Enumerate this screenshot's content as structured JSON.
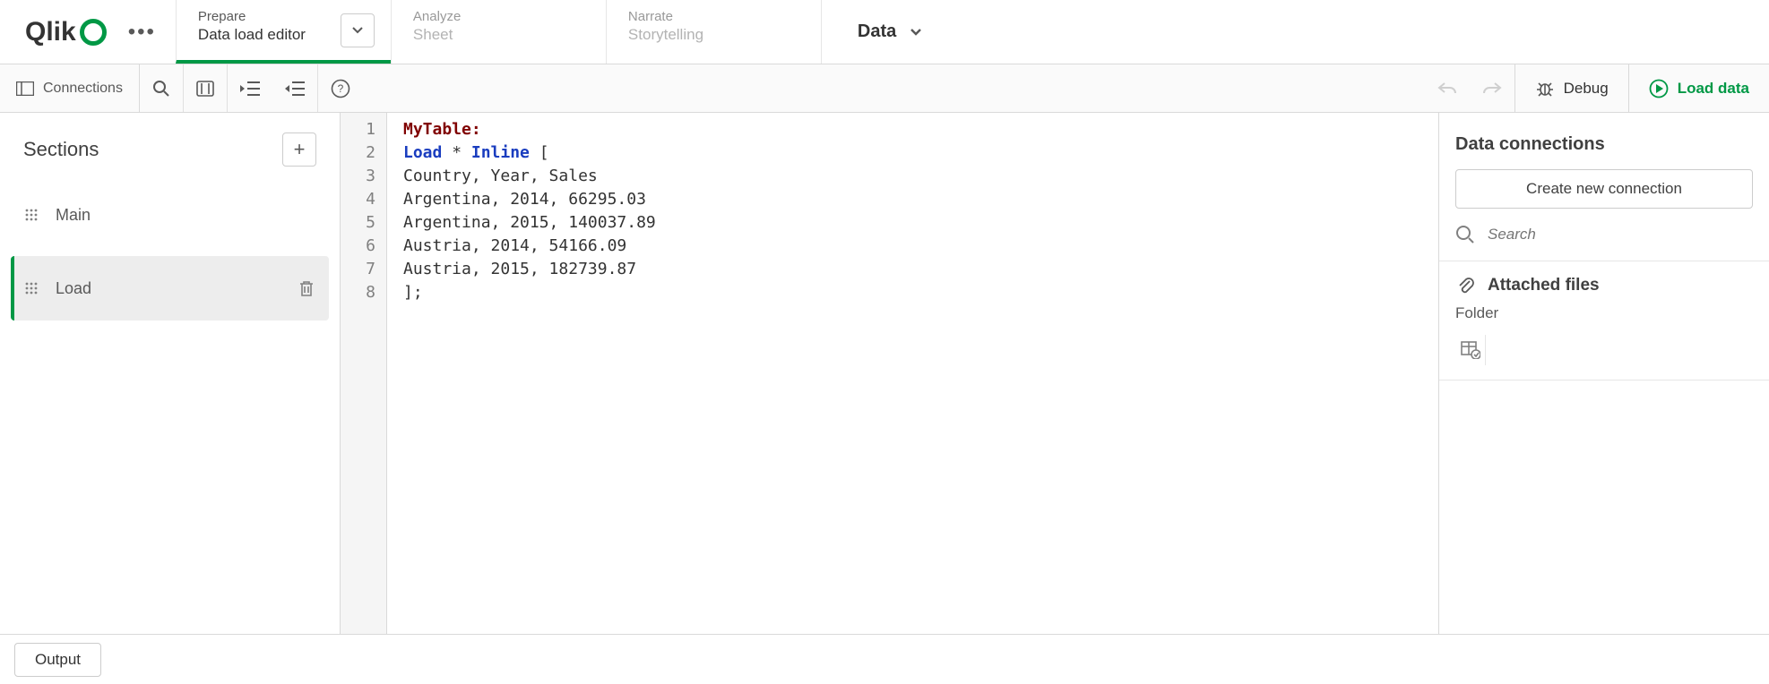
{
  "header": {
    "logo_text": "Qlik",
    "nav": [
      {
        "step": "Prepare",
        "subtitle": "Data load editor",
        "active": true,
        "has_chevron": true
      },
      {
        "step": "Analyze",
        "subtitle": "Sheet",
        "active": false,
        "has_chevron": false
      },
      {
        "step": "Narrate",
        "subtitle": "Storytelling",
        "active": false,
        "has_chevron": false
      }
    ],
    "data_dropdown": "Data"
  },
  "toolbar": {
    "connections_label": "Connections",
    "debug_label": "Debug",
    "load_data_label": "Load data"
  },
  "sections": {
    "title": "Sections",
    "items": [
      {
        "label": "Main",
        "active": false
      },
      {
        "label": "Load",
        "active": true
      }
    ]
  },
  "code": {
    "lines": [
      {
        "n": "1",
        "type": "label",
        "text": "MyTable:"
      },
      {
        "n": "2",
        "type": "load",
        "kw1": "Load",
        "mid": " * ",
        "kw2": "Inline",
        "tail": " ["
      },
      {
        "n": "3",
        "type": "plain",
        "text": "Country, Year, Sales"
      },
      {
        "n": "4",
        "type": "plain",
        "text": "Argentina, 2014, 66295.03"
      },
      {
        "n": "5",
        "type": "plain",
        "text": "Argentina, 2015, 140037.89"
      },
      {
        "n": "6",
        "type": "plain",
        "text": "Austria, 2014, 54166.09"
      },
      {
        "n": "7",
        "type": "plain",
        "text": "Austria, 2015, 182739.87"
      },
      {
        "n": "8",
        "type": "plain",
        "text": "];"
      }
    ]
  },
  "connections": {
    "title": "Data connections",
    "create_label": "Create new connection",
    "search_placeholder": "Search",
    "attached_label": "Attached files",
    "folder_label": "Folder"
  },
  "bottom": {
    "output_label": "Output"
  }
}
